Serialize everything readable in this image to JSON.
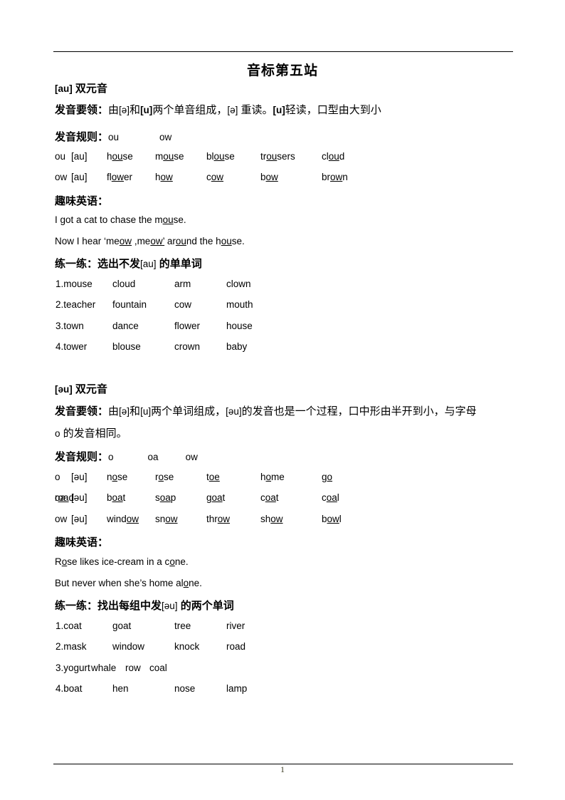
{
  "document": {
    "title": "音标第五站",
    "page_number": "1"
  },
  "section1": {
    "heading_ipa": "[au]",
    "heading_text": "双元音",
    "key_label": "发音要领：",
    "key_text_a": "由",
    "key_ipa1": "[ə]",
    "key_text_b": "和",
    "key_ipa2": "[u]",
    "key_text_c": "两个单音组成，",
    "key_ipa3": "[ə]",
    "key_text_d": " 重读。",
    "key_ipa4": "[u]",
    "key_text_e": "轻读，口型由大到小",
    "rules_label": "发音规则：",
    "rule_items": [
      "ou",
      "ow"
    ],
    "word_rows": [
      {
        "spelling": "ou",
        "ipa": "[au]",
        "words": [
          {
            "pre": "h",
            "mid": "ou",
            "post": "se"
          },
          {
            "pre": "m",
            "mid": "ou",
            "post": "se"
          },
          {
            "pre": "bl",
            "mid": "ou",
            "post": "se"
          },
          {
            "pre": "tr",
            "mid": "ou",
            "post": "sers"
          },
          {
            "pre": "cl",
            "mid": "ou",
            "post": "d"
          }
        ]
      },
      {
        "spelling": "ow",
        "ipa": "[au]",
        "words": [
          {
            "pre": "fl",
            "mid": "ow",
            "post": "er"
          },
          {
            "pre": "h",
            "mid": "ow",
            "post": ""
          },
          {
            "pre": "c",
            "mid": "ow",
            "post": ""
          },
          {
            "pre": "b",
            "mid": "ow",
            "post": ""
          },
          {
            "pre": "br",
            "mid": "ow",
            "post": "n"
          }
        ]
      }
    ],
    "fun_label": "趣味英语：",
    "fun_lines": [
      [
        {
          "t": "I got a cat to chase the m",
          "u": false
        },
        {
          "t": "ou",
          "u": true
        },
        {
          "t": "se.",
          "u": false
        }
      ],
      [
        {
          "t": "Now I hear ‘me",
          "u": false
        },
        {
          "t": "ow",
          "u": true
        },
        {
          "t": " ,me",
          "u": false
        },
        {
          "t": "ow’",
          "u": true
        },
        {
          "t": " ar",
          "u": false
        },
        {
          "t": "ou",
          "u": true
        },
        {
          "t": "nd the h",
          "u": false
        },
        {
          "t": "ou",
          "u": true
        },
        {
          "t": "se.",
          "u": false
        }
      ]
    ],
    "practice_label": "练一练：",
    "practice_text_a": "选出不发",
    "practice_ipa": "[au]",
    "practice_text_b": " 的单单词",
    "practice_rows": [
      [
        "1.mouse",
        "cloud",
        "arm",
        "clown"
      ],
      [
        "2.teacher",
        "fountain",
        "cow",
        "mouth"
      ],
      [
        "3.town",
        "dance",
        "flower",
        "house"
      ],
      [
        "4.tower",
        "blouse",
        "crown",
        "baby"
      ]
    ]
  },
  "section2": {
    "heading_ipa": "[əu]",
    "heading_text": "双元音",
    "key_label": "发音要领：",
    "key_text_a": "由",
    "key_ipa1": "[ə]",
    "key_text_b": "和",
    "key_ipa2": "[u]",
    "key_text_c": "两个单词组成，",
    "key_ipa3": "[əu]",
    "key_text_d": "的发音也是一个过程，口中形由半开到小，与字母",
    "key_line2_a": "o",
    "key_line2_b": " 的发音相同。",
    "rules_label": "发音规则：",
    "rule_items": [
      "o",
      "oa",
      "ow"
    ],
    "word_rows": [
      {
        "spelling": "o",
        "ipa": "[əu]",
        "words": [
          {
            "pre": "n",
            "mid": "o",
            "post": "se"
          },
          {
            "pre": "r",
            "mid": "o",
            "post": "se"
          },
          {
            "pre": "t",
            "mid": "oe",
            "post": ""
          },
          {
            "pre": "h",
            "mid": "o",
            "post": "me"
          },
          {
            "pre": "g",
            "mid": "o",
            "post": ""
          }
        ]
      },
      {
        "spelling": "oa",
        "ipa": "[əu]",
        "words": [
          {
            "pre": "b",
            "mid": "oa",
            "post": "t"
          },
          {
            "pre": "s",
            "mid": "oa",
            "post": "p"
          },
          {
            "pre": "g",
            "mid": "oa",
            "post": "t"
          },
          {
            "pre": "c",
            "mid": "oa",
            "post": "t"
          },
          {
            "pre": "c",
            "mid": "oa",
            "post": "l"
          },
          {
            "pre": "r",
            "mid": "oa",
            "post": "d"
          }
        ]
      },
      {
        "spelling": "ow",
        "ipa": "[əu]",
        "words": [
          {
            "pre": "wind",
            "mid": "ow",
            "post": ""
          },
          {
            "pre": "sn",
            "mid": "ow",
            "post": ""
          },
          {
            "pre": "thr",
            "mid": "ow",
            "post": ""
          },
          {
            "pre": "sh",
            "mid": "ow",
            "post": ""
          },
          {
            "pre": "b",
            "mid": "ow",
            "post": "l"
          }
        ]
      }
    ],
    "fun_label": "趣味英语：",
    "fun_lines": [
      [
        {
          "t": "R",
          "u": false
        },
        {
          "t": "o",
          "u": true
        },
        {
          "t": "se likes ice-cream in a c",
          "u": false
        },
        {
          "t": "o",
          "u": true
        },
        {
          "t": "ne.",
          "u": false
        }
      ],
      [
        {
          "t": "But never when she’s home al",
          "u": false
        },
        {
          "t": "o",
          "u": true
        },
        {
          "t": "ne.",
          "u": false
        }
      ]
    ],
    "practice_label": "练一练：",
    "practice_text_a": "找出每组中发",
    "practice_ipa": "[əu]",
    "practice_text_b": " 的两个单词",
    "practice_rows": [
      [
        "1.coat",
        "goat",
        "tree",
        "river"
      ],
      [
        "2.mask",
        "window",
        "knock",
        "road"
      ],
      [
        "3.yogurt",
        "whale",
        "row",
        "coal"
      ],
      [
        "4.boat",
        "hen",
        "nose",
        "lamp"
      ]
    ]
  },
  "layout": {
    "word_cols": [
      77,
      100,
      150,
      218,
      290,
      366,
      452
    ],
    "list_cols": [
      78,
      158,
      245,
      318
    ],
    "list_cols_tight": [
      78,
      128,
      176,
      210
    ]
  }
}
